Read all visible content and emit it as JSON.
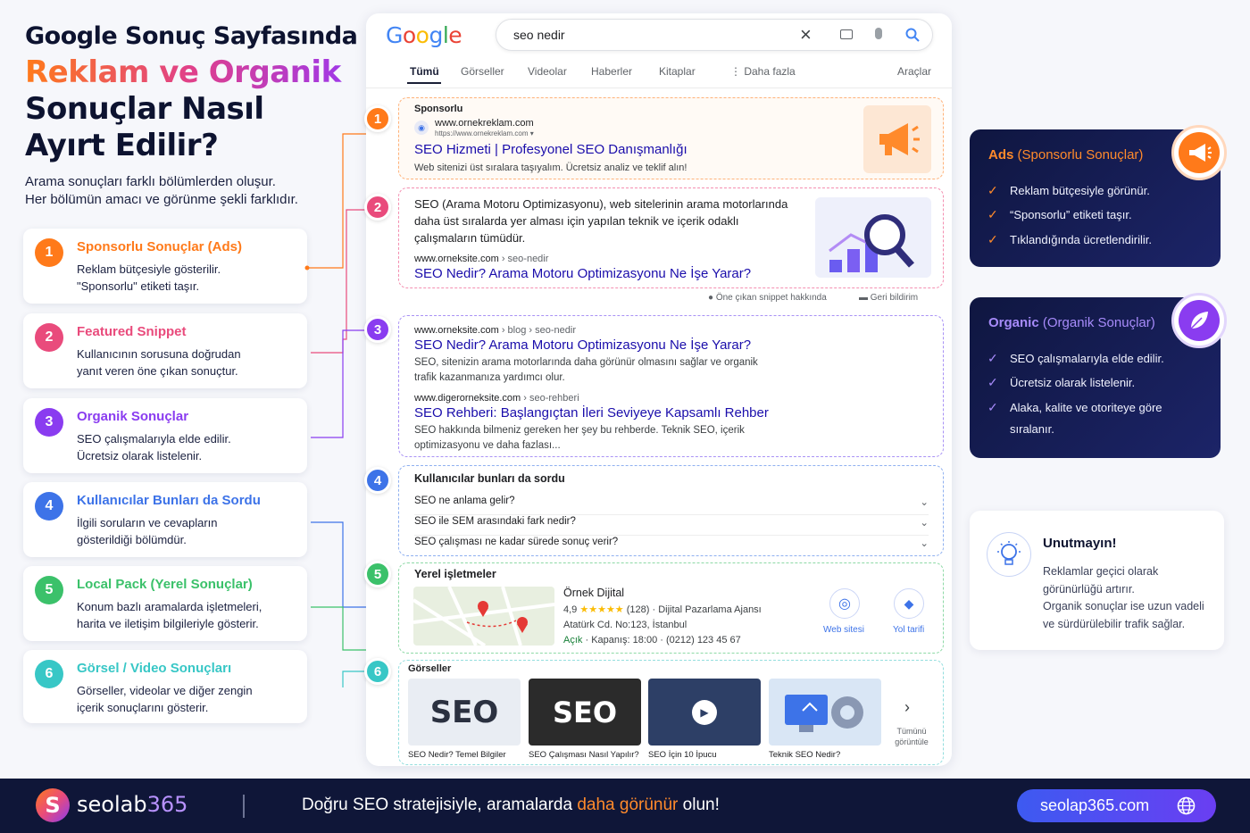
{
  "header": {
    "line1": "Google Sonuç Sayfasında",
    "line2": "Reklam ve Organik",
    "line3": "Sonuçlar Nasıl",
    "line4": "Ayırt Edilir?"
  },
  "intro": {
    "line1": "Arama sonuçları farklı bölümlerden oluşur.",
    "line2": "Her bölümün amacı ve görünme şekli farklıdır."
  },
  "left_cards": [
    {
      "num": "1",
      "title": "Sponsorlu Sonuçlar (Ads)",
      "d1": "Reklam bütçesiyle gösterilir.",
      "d2": "\"Sponsorlu\" etiketi taşır."
    },
    {
      "num": "2",
      "title": "Featured Snippet",
      "d1": "Kullanıcının sorusuna doğrudan",
      "d2": "yanıt veren öne çıkan sonuçtur."
    },
    {
      "num": "3",
      "title": "Organik Sonuçlar",
      "d1": "SEO çalışmalarıyla elde edilir.",
      "d2": "Ücretsiz olarak listelenir."
    },
    {
      "num": "4",
      "title": "Kullanıcılar Bunları da Sordu",
      "d1": "İlgili soruların ve cevapların",
      "d2": "gösterildiği bölümdür."
    },
    {
      "num": "5",
      "title": "Local Pack (Yerel Sonuçlar)",
      "d1": "Konum bazlı aramalarda işletmeleri,",
      "d2": "harita ve iletişim bilgileriyle gösterir."
    },
    {
      "num": "6",
      "title": "Görsel / Video Sonuçları",
      "d1": "Görseller, videolar ve diğer zengin",
      "d2": "içerik sonuçlarını gösterir."
    }
  ],
  "google": {
    "logo": "Google",
    "query": "seo nedir",
    "tabs": [
      "Tümü",
      "Görseller",
      "Videolar",
      "Haberler",
      "Kitaplar",
      "⋮ Daha fazla",
      "Araçlar"
    ],
    "ad": {
      "label": "Sponsorlu",
      "domain": "www.ornekreklam.com",
      "url": "https://www.ornekreklam.com",
      "title": "SEO Hizmeti | Profesyonel SEO Danışmanlığı",
      "desc": "Web sitenizi üst sıralara taşıyalım. Ücretsiz analiz ve teklif alın!"
    },
    "snippet": {
      "l1": "SEO (Arama Motoru Optimizasyonu), web sitelerinin arama motorlarında",
      "l2": "daha üst sıralarda yer alması için yapılan teknik ve içerik odaklı",
      "l3": "çalışmaların tümüdür.",
      "domain": "www.orneksite.com",
      "path": "› seo-nedir",
      "title": "SEO Nedir? Arama Motoru Optimizasyonu Ne İşe Yarar?",
      "about": "Öne çıkan snippet hakkında",
      "feedback": "Geri bildirim"
    },
    "organic": [
      {
        "domain": "www.orneksite.com",
        "path": "› blog › seo-nedir",
        "title": "SEO Nedir? Arama Motoru Optimizasyonu Ne İşe Yarar?",
        "d1": "SEO, sitenizin arama motorlarında daha görünür olmasını sağlar ve organik",
        "d2": "trafik kazanmanıza yardımcı olur."
      },
      {
        "domain": "www.digerorneksite.com",
        "path": "› seo-rehberi",
        "title": "SEO Rehberi: Başlangıçtan İleri Seviyeye Kapsamlı Rehber",
        "d1": "SEO hakkında bilmeniz gereken her şey bu rehberde. Teknik SEO, içerik",
        "d2": "optimizasyonu ve daha fazlası..."
      }
    ],
    "paa": {
      "title": "Kullanıcılar bunları da sordu",
      "questions": [
        "SEO ne anlama gelir?",
        "SEO ile SEM arasındaki fark nedir?",
        "SEO çalışması ne kadar sürede sonuç verir?"
      ]
    },
    "local": {
      "title": "Yerel işletmeler",
      "name": "Örnek Dijital",
      "rating": "4,9",
      "stars": "★★★★★",
      "reviews": "(128) · Dijital Pazarlama Ajansı",
      "address": "Atatürk Cd. No:123, İstanbul",
      "open": "Açık",
      "hours": "· Kapanış: 18:00 · (0212) 123 45 67",
      "website": "Web sitesi",
      "directions": "Yol tarifi"
    },
    "images": {
      "title": "Görseller",
      "items": [
        {
          "text": "SEO",
          "caption": "SEO Nedir? Temel Bilgiler"
        },
        {
          "text": "SEO",
          "caption": "SEO Çalışması Nasıl Yapılır?"
        },
        {
          "text": "",
          "caption": "SEO İçin 10 İpucu"
        },
        {
          "text": "",
          "caption": "Teknik SEO Nedir?"
        }
      ],
      "more1": "Tümünü",
      "more2": "görüntüle"
    }
  },
  "markers": [
    "1",
    "2",
    "3",
    "4",
    "5",
    "6"
  ],
  "ads_card": {
    "title_a": "Ads",
    "title_b": "(Sponsorlu Sonuçlar)",
    "items": [
      "Reklam bütçesiyle görünür.",
      "“Sponsorlu” etiketi taşır.",
      "Tıklandığında ücretlendirilir."
    ]
  },
  "organic_card": {
    "title_a": "Organic",
    "title_b": "(Organik Sonuçlar)",
    "items": [
      "SEO çalışmalarıyla elde edilir.",
      "Ücretsiz olarak listelenir.",
      "Alaka, kalite ve otoriteye göre",
      "sıralanır."
    ]
  },
  "reminder": {
    "title": "Unutmayın!",
    "l1": "Reklamlar geçici olarak",
    "l2": "görünürlüğü artırır.",
    "l3": "Organik sonuçlar ise uzun vadeli",
    "l4": "ve sürdürülebilir trafik sağlar."
  },
  "footer": {
    "brand_a": "seolab",
    "brand_b": "365",
    "slogan_a": "Doğru SEO stratejisiyle, aramalarda ",
    "slogan_b": "daha görünür",
    "slogan_c": " olun!",
    "site": "seolap365.com"
  },
  "colors": {
    "orange": "#ff7a1a",
    "pink": "#e94b7c",
    "purple": "#8a3cf0",
    "blue": "#3d73e8",
    "green": "#3bc16a",
    "teal": "#38c7c6",
    "navy": "#0f1638",
    "link": "#1a0dab"
  }
}
